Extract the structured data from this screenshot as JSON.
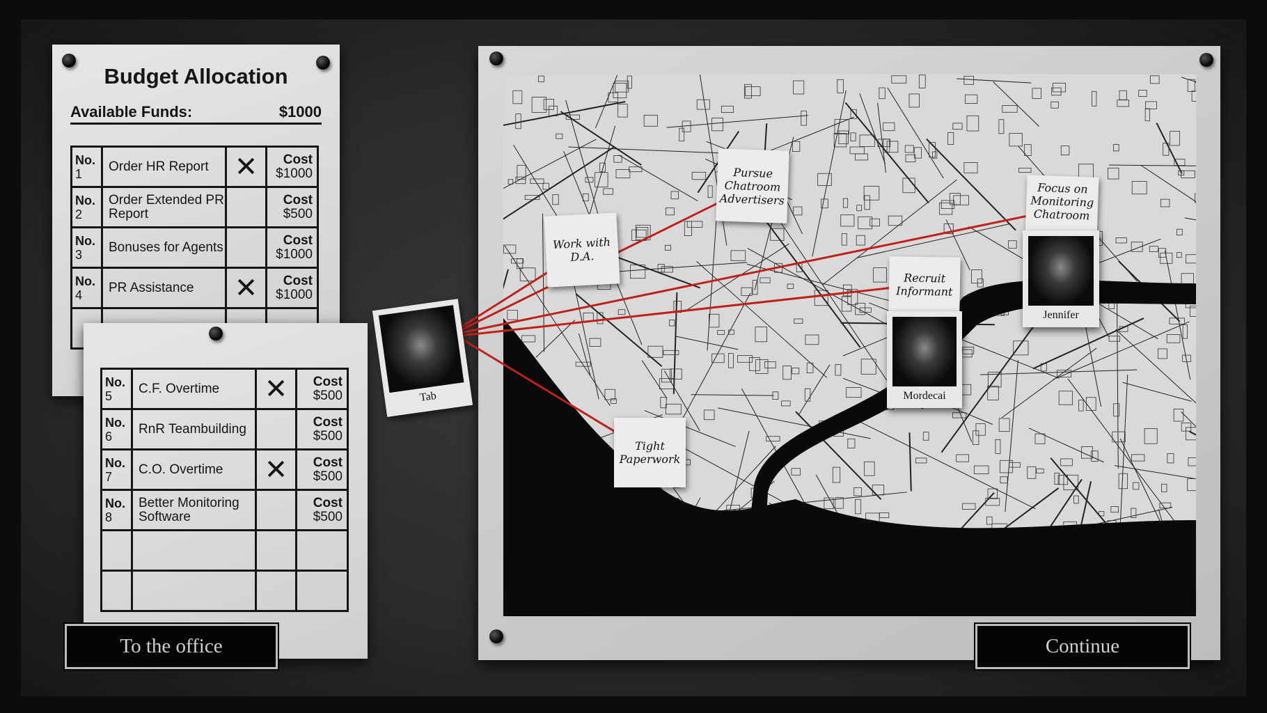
{
  "budget": {
    "title": "Budget Allocation",
    "funds_label": "Available Funds:",
    "funds_value": "$1000",
    "items": [
      {
        "no_label": "No.",
        "no": "1",
        "name": "Order HR Report",
        "selected": true,
        "cost_label": "Cost",
        "cost": "$1000"
      },
      {
        "no_label": "No.",
        "no": "2",
        "name": "Order Extended PR Report",
        "selected": false,
        "cost_label": "Cost",
        "cost": "$500"
      },
      {
        "no_label": "No.",
        "no": "3",
        "name": "Bonuses for Agents",
        "selected": false,
        "cost_label": "Cost",
        "cost": "$1000"
      },
      {
        "no_label": "No.",
        "no": "4",
        "name": "PR Assistance",
        "selected": true,
        "cost_label": "Cost",
        "cost": "$1000"
      },
      {
        "no_label": "No.",
        "no": "5",
        "name": "C.F. Overtime",
        "selected": true,
        "cost_label": "Cost",
        "cost": "$500"
      },
      {
        "no_label": "No.",
        "no": "6",
        "name": "RnR Teambuilding",
        "selected": false,
        "cost_label": "Cost",
        "cost": "$500"
      },
      {
        "no_label": "No.",
        "no": "7",
        "name": "C.O. Overtime",
        "selected": true,
        "cost_label": "Cost",
        "cost": "$500"
      },
      {
        "no_label": "No.",
        "no": "8",
        "name": "Better Monitoring Software",
        "selected": false,
        "cost_label": "Cost",
        "cost": "$500"
      }
    ],
    "check_mark": "✕"
  },
  "buttons": {
    "office": "To the office",
    "continue": "Continue"
  },
  "map": {
    "notes": [
      "Work with D.A.",
      "Pursue Chatroom Advertisers",
      "Focus on Monitoring Chatroom",
      "Recruit Informant",
      "Tight Paperwork"
    ],
    "agents": [
      "Tab",
      "Mordecai",
      "Jennifer"
    ]
  },
  "colors": {
    "string": "#c0201a",
    "water": "#0a0a0a"
  }
}
